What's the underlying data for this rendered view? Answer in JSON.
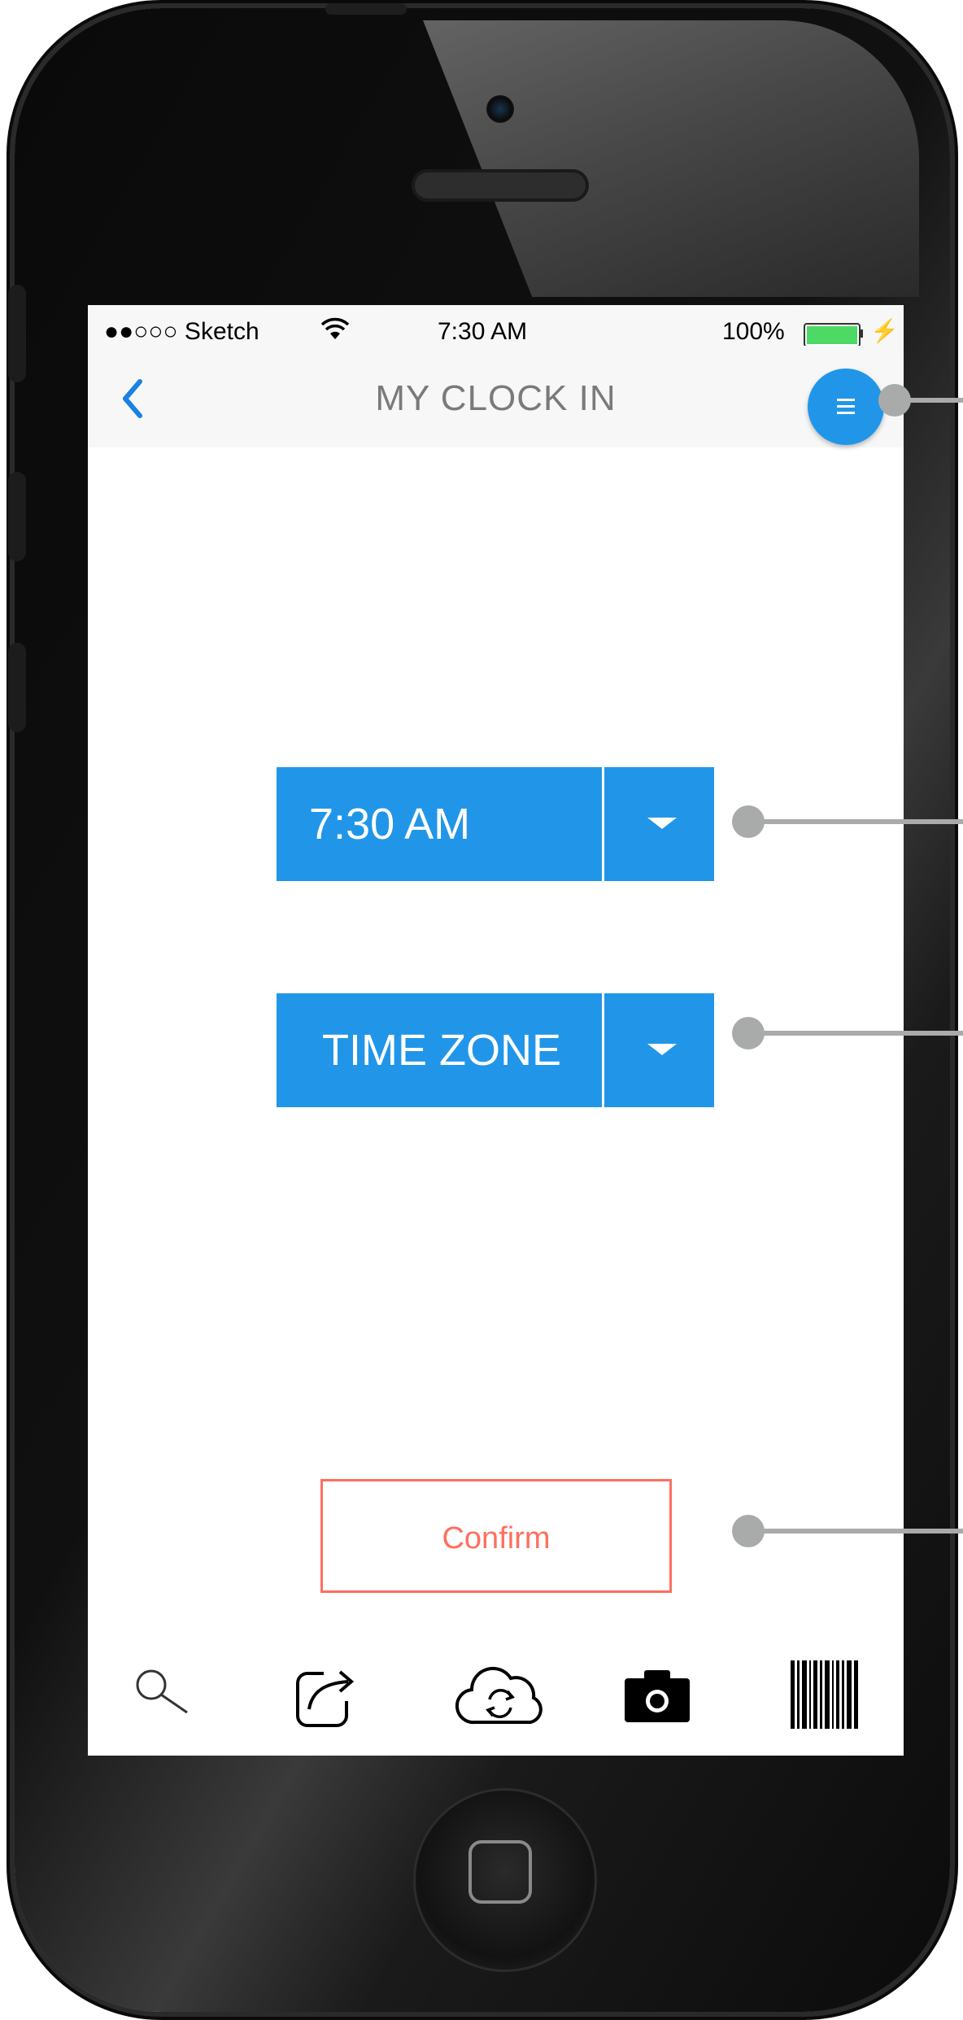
{
  "status_bar": {
    "carrier": "●●○○○ Sketch",
    "wifi_icon": "wifi-icon",
    "time": "7:30 AM",
    "battery_percent": "100%",
    "battery_level": 1.0,
    "charging_icon": "bolt-icon"
  },
  "nav": {
    "back_icon": "chevron-left-icon",
    "title": "MY CLOCK IN",
    "menu_icon": "hamburger-icon"
  },
  "time_select": {
    "value": "7:30 AM",
    "dropdown_icon": "caret-down-icon"
  },
  "timezone_select": {
    "value": "TIME ZONE",
    "dropdown_icon": "caret-down-icon"
  },
  "confirm_button": {
    "label": "Confirm"
  },
  "toolbar": {
    "items": [
      "search-icon",
      "share-icon",
      "cloud-sync-icon",
      "camera-icon",
      "barcode-icon"
    ]
  },
  "colors": {
    "accent": "#2196e8",
    "back_arrow": "#1a82e2",
    "confirm": "#ff6f5e",
    "callout": "#a8aba9",
    "battery": "#4cd964"
  }
}
